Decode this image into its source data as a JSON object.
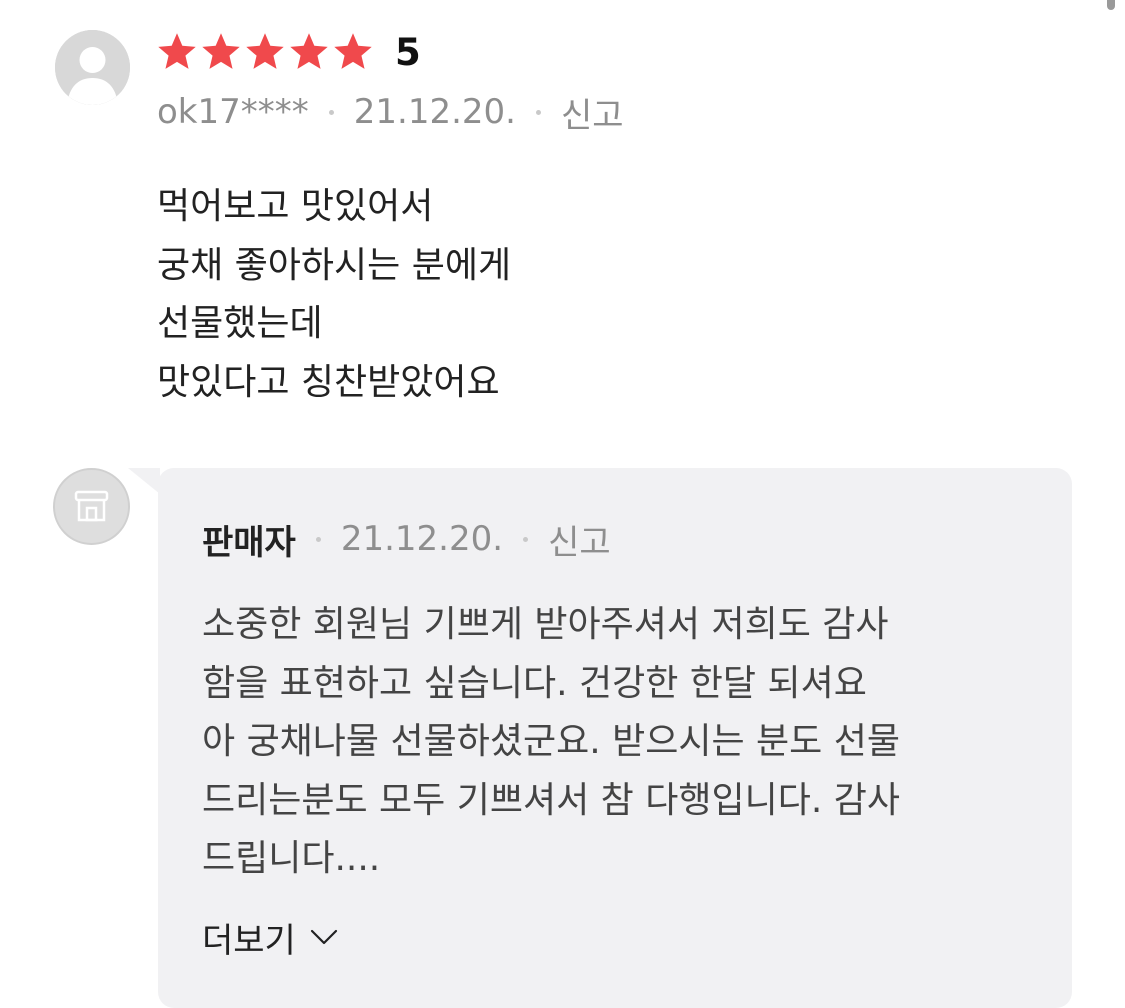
{
  "review": {
    "rating_value": 5,
    "rating_max": 5,
    "score_text": "5",
    "user_id": "ok17****",
    "date": "21.12.20.",
    "report_label": "신고",
    "body_lines": [
      "먹어보고 맛있어서",
      "궁채 좋아하시는 분에게",
      "선물했는데",
      "맛있다고 칭찬받았어요"
    ]
  },
  "reply": {
    "seller_label": "판매자",
    "date": "21.12.20.",
    "report_label": "신고",
    "body_lines": [
      "소중한 회원님 기쁘게 받아주셔서 저희도 감사",
      "함을 표현하고 싶습니다. 건강한 한달 되셔요",
      "아 궁채나물 선물하셨군요. 받으시는 분도 선물",
      "드리는분도 모두 기쁘셔서 참 다행입니다. 감사",
      "드립니다...."
    ],
    "more_label": "더보기"
  },
  "colors": {
    "star": "#f0494c",
    "meta_text": "#8e8e8e",
    "reply_background": "#f1f1f3",
    "avatar_background": "#d8d8d8"
  },
  "icons": {
    "user_avatar": "default-user-icon",
    "seller_avatar": "store-icon",
    "star": "star-icon",
    "more": "chevron-down-icon"
  }
}
